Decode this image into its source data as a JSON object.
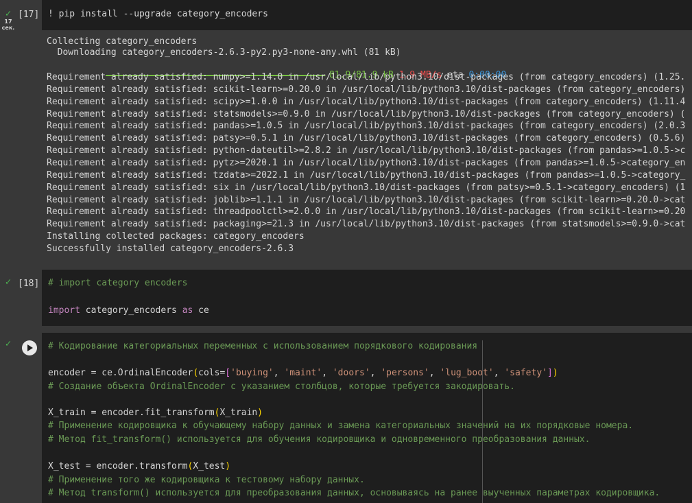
{
  "cell17": {
    "status_icon": "check-icon",
    "runtime_value": "17",
    "runtime_unit": "сек.",
    "exec_count": "[17]",
    "code": "! pip install --upgrade category_encoders",
    "output": {
      "collecting": "Collecting category_encoders",
      "downloading": "  Downloading category_encoders-2.6.3-py2.py3-none-any.whl (81 kB)",
      "progress_size": "81.9/81.9 kB",
      "progress_speed": "1.9 MB/s",
      "progress_eta_label": "eta",
      "progress_eta": "0:00:00",
      "progress_fraction": 1.0,
      "requirements": [
        "Requirement already satisfied: numpy>=1.14.0 in /usr/local/lib/python3.10/dist-packages (from category_encoders) (1.25.",
        "Requirement already satisfied: scikit-learn>=0.20.0 in /usr/local/lib/python3.10/dist-packages (from category_encoders)",
        "Requirement already satisfied: scipy>=1.0.0 in /usr/local/lib/python3.10/dist-packages (from category_encoders) (1.11.4",
        "Requirement already satisfied: statsmodels>=0.9.0 in /usr/local/lib/python3.10/dist-packages (from category_encoders) (",
        "Requirement already satisfied: pandas>=1.0.5 in /usr/local/lib/python3.10/dist-packages (from category_encoders) (2.0.3",
        "Requirement already satisfied: patsy>=0.5.1 in /usr/local/lib/python3.10/dist-packages (from category_encoders) (0.5.6)",
        "Requirement already satisfied: python-dateutil>=2.8.2 in /usr/local/lib/python3.10/dist-packages (from pandas>=1.0.5->c",
        "Requirement already satisfied: pytz>=2020.1 in /usr/local/lib/python3.10/dist-packages (from pandas>=1.0.5->category_en",
        "Requirement already satisfied: tzdata>=2022.1 in /usr/local/lib/python3.10/dist-packages (from pandas>=1.0.5->category_",
        "Requirement already satisfied: six in /usr/local/lib/python3.10/dist-packages (from patsy>=0.5.1->category_encoders) (1",
        "Requirement already satisfied: joblib>=1.1.1 in /usr/local/lib/python3.10/dist-packages (from scikit-learn>=0.20.0->cat",
        "Requirement already satisfied: threadpoolctl>=2.0.0 in /usr/local/lib/python3.10/dist-packages (from scikit-learn>=0.20",
        "Requirement already satisfied: packaging>=21.3 in /usr/local/lib/python3.10/dist-packages (from statsmodels>=0.9.0->cat"
      ],
      "installing": "Installing collected packages: category_encoders",
      "success": "Successfully installed category_encoders-2.6.3"
    }
  },
  "cell18": {
    "status_icon": "check-icon",
    "exec_count": "[18]",
    "comment": "# import category encoders",
    "import_kw": "import",
    "module": " category_encoders ",
    "as_kw": "as",
    "alias": " ce"
  },
  "cell19": {
    "status_icon": "check-icon",
    "run_icon": "play-icon",
    "lines": {
      "c1": "# Кодирование категориальных переменных с использованием порядкового кодирования",
      "enc_a": "encoder = ce.OrdinalEncoder",
      "enc_p1": "(",
      "enc_b": "cols=",
      "enc_p2": "[",
      "s1": "'buying'",
      "sep": ", ",
      "s2": "'maint'",
      "s3": "'doors'",
      "s4": "'persons'",
      "s5": "'lug_boot'",
      "s6": "'safety'",
      "enc_p3": "]",
      "enc_p4": ")",
      "c2": "# Создание объекта OrdinalEncoder с указанием столбцов, которые требуется закодировать.",
      "xtrain_a": "X_train = encoder.fit_transform",
      "xtrain_p1": "(",
      "xtrain_b": "X_train",
      "xtrain_p2": ")",
      "c3": "# Применение кодировщика к обучающему набору данных и замена категориальных значений на их порядковые номера.",
      "c4": "# Метод fit_transform() используется для обучения кодировщика и одновременного преобразования данных.",
      "xtest_a": "X_test = encoder.transform",
      "xtest_p1": "(",
      "xtest_b": "X_test",
      "xtest_p2": ")",
      "c5": "# Применение того же кодировщика к тестовому набору данных.",
      "c6": "# Метод transform() используется для преобразования данных, основываясь на ранее выученных параметрах кодировщика."
    }
  },
  "colors": {
    "background": "#383838",
    "code_background": "#1e1e1e",
    "comment": "#6a9955",
    "keyword": "#c586c0",
    "string": "#ce9178",
    "success_check": "#4caf50",
    "progress": "#76c043",
    "speed": "#f14c4c",
    "eta": "#3a96dd"
  }
}
